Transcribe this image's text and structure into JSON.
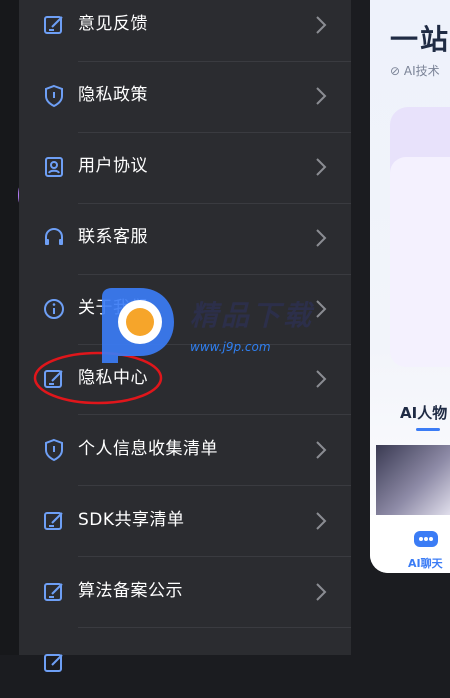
{
  "drawer": {
    "items": [
      {
        "label": "意见反馈",
        "icon": "edit-icon"
      },
      {
        "label": "隐私政策",
        "icon": "shield-icon"
      },
      {
        "label": "用户协议",
        "icon": "user-badge-icon"
      },
      {
        "label": "联系客服",
        "icon": "headset-icon"
      },
      {
        "label": "关于我们",
        "icon": "info-icon"
      },
      {
        "label": "隐私中心",
        "icon": "edit-icon"
      },
      {
        "label": "个人信息收集清单",
        "icon": "shield-icon"
      },
      {
        "label": "SDK共享清单",
        "icon": "edit-icon"
      },
      {
        "label": "算法备案公示",
        "icon": "edit-icon"
      }
    ]
  },
  "panel": {
    "title": "一站",
    "subtitle": "AI技术",
    "section": "AI人物",
    "nav_label": "AI聊天"
  },
  "watermark": {
    "text": "精品下载",
    "url": "www.j9p.com"
  },
  "colors": {
    "accent": "#3b7cf5",
    "icon": "#6e9ff5",
    "highlight": "#e0161b"
  }
}
